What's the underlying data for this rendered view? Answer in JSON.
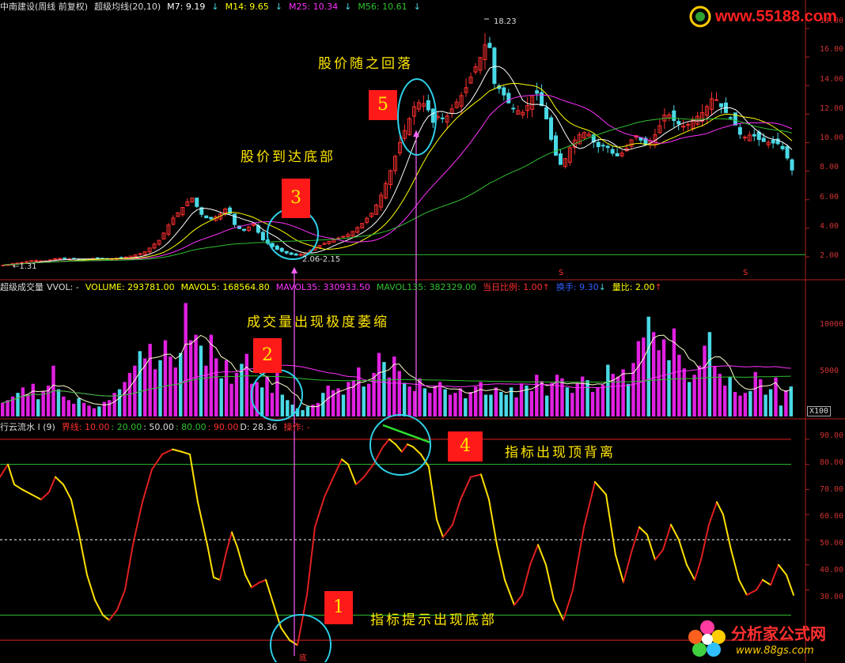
{
  "price_header": {
    "name": "中南建设(周线 前复权)",
    "indicator": "超级均线(20,10)",
    "m7": "M7: 9.19",
    "m14": "M14: 9.65",
    "m25": "M25: 10.34",
    "m56": "M56: 10.61",
    "arrow": "↓"
  },
  "volume_header": {
    "name": "超级成交量",
    "vvol": "VVOL: -",
    "volume": "VOLUME: 293781.00",
    "mavol5": "MAVOL5: 168564.80",
    "mavol35": "MAVOL35: 330933.50",
    "mavol135": "MAVOL135: 382329.00",
    "ratio": "当日比例: 1.00",
    "turnover": "换手: 9.30",
    "liangbi": "量比: 2.00",
    "up_arrow": "↑",
    "down_arrow": "↓"
  },
  "osc_header": {
    "name": "行云流水 I (9)",
    "jiexian": "界线: 10.00",
    "v20": ": 20.00",
    "v50": ": 50.00",
    "v80": ": 80.00",
    "v90": ": 90.00",
    "d": "D: 28.36",
    "op": "操作: -"
  },
  "price_axis": [
    "18.00",
    "16.00",
    "14.00",
    "12.00",
    "10.00",
    "8.00",
    "6.00",
    "4.00",
    "2.00"
  ],
  "volume_axis": [
    "10000",
    "5000"
  ],
  "volume_unit": "X100",
  "osc_axis": [
    "90.00",
    "80.00",
    "70.00",
    "60.00",
    "50.00",
    "40.00",
    "30.00"
  ],
  "price_labels": {
    "high": "18.23",
    "low_start": "1.31",
    "bottom_range": "2.06-2.15",
    "signal_marker": "S",
    "bottom_marker": "底"
  },
  "annotations": {
    "one": {
      "num": "1",
      "text": "指标提示出现底部"
    },
    "two": {
      "num": "2",
      "text": "成交量出现极度萎缩"
    },
    "three": {
      "num": "3",
      "text": "股价到达底部"
    },
    "four": {
      "num": "4",
      "text": "指标出现顶背离"
    },
    "five": {
      "num": "5",
      "text": "股价随之回落"
    }
  },
  "logos": {
    "top": "www.55188.com",
    "bottom_cn": "分析家公式网",
    "bottom_url": "www.88gs.com"
  },
  "colors": {
    "up": "#ff3030",
    "down": "#4ad9e6",
    "m7": "#ffffff",
    "m14": "#ffff00",
    "m25": "#ff30ff",
    "m56": "#30c030",
    "vol_bar": "#e020e0",
    "osc_up": "#e02020",
    "osc_down": "#ffe000",
    "circle": "#2ed0e8"
  },
  "chart_data": [
    {
      "type": "candlestick",
      "title": "中南建设(周线 前复权)",
      "ylim": [
        1,
        19
      ],
      "y_ticks": [
        2,
        4,
        6,
        8,
        10,
        12,
        14,
        16,
        18
      ],
      "series": [
        {
          "name": "M7",
          "last": 9.19
        },
        {
          "name": "M14",
          "last": 9.65
        },
        {
          "name": "M25",
          "last": 10.34
        },
        {
          "name": "M56",
          "last": 10.61
        }
      ],
      "annotations": [
        {
          "label": "18.23",
          "value": 18.23
        },
        {
          "label": "1.31",
          "value": 1.31
        },
        {
          "label": "2.06-2.15",
          "value": [
            2.06,
            2.15
          ]
        }
      ],
      "path_points": [
        [
          0,
          1.4
        ],
        [
          12,
          1.5
        ],
        [
          25,
          1.6
        ],
        [
          40,
          1.75
        ],
        [
          55,
          1.7
        ],
        [
          70,
          1.9
        ],
        [
          85,
          1.85
        ],
        [
          100,
          1.8
        ],
        [
          120,
          1.9
        ],
        [
          140,
          1.85
        ],
        [
          160,
          2.0
        ],
        [
          180,
          2.3
        ],
        [
          200,
          3.2
        ],
        [
          215,
          4.6
        ],
        [
          228,
          5.4
        ],
        [
          240,
          6.2
        ],
        [
          252,
          5.0
        ],
        [
          262,
          4.6
        ],
        [
          275,
          4.9
        ],
        [
          285,
          5.5
        ],
        [
          295,
          4.2
        ],
        [
          305,
          3.8
        ],
        [
          318,
          4.3
        ],
        [
          330,
          3.2
        ],
        [
          345,
          2.6
        ],
        [
          358,
          2.3
        ],
        [
          370,
          2.1
        ],
        [
          382,
          2.2
        ],
        [
          395,
          2.6
        ],
        [
          410,
          3.0
        ],
        [
          425,
          3.3
        ],
        [
          440,
          3.6
        ],
        [
          455,
          4.3
        ],
        [
          470,
          5.2
        ],
        [
          482,
          6.6
        ],
        [
          492,
          8.1
        ],
        [
          502,
          9.8
        ],
        [
          512,
          11.2
        ],
        [
          522,
          12.6
        ],
        [
          530,
          12.9
        ],
        [
          538,
          12.5
        ],
        [
          545,
          11.4
        ],
        [
          552,
          11.9
        ],
        [
          560,
          11.6
        ],
        [
          572,
          12.6
        ],
        [
          585,
          13.6
        ],
        [
          598,
          15.2
        ],
        [
          608,
          16.3
        ],
        [
          615,
          17.6
        ],
        [
          622,
          14.2
        ],
        [
          632,
          13.6
        ],
        [
          645,
          12.4
        ],
        [
          660,
          12.1
        ],
        [
          675,
          13.7
        ],
        [
          688,
          11.8
        ],
        [
          698,
          9.4
        ],
        [
          708,
          8.3
        ],
        [
          718,
          9.6
        ],
        [
          728,
          10.5
        ],
        [
          740,
          10.8
        ],
        [
          752,
          9.7
        ],
        [
          764,
          9.8
        ],
        [
          776,
          9.0
        ],
        [
          788,
          9.4
        ],
        [
          800,
          10.6
        ],
        [
          815,
          9.8
        ],
        [
          828,
          10.7
        ],
        [
          840,
          12.2
        ],
        [
          852,
          11.4
        ],
        [
          864,
          11.1
        ],
        [
          876,
          11.7
        ],
        [
          888,
          12.2
        ],
        [
          900,
          13.3
        ],
        [
          912,
          12.3
        ],
        [
          924,
          11.6
        ],
        [
          936,
          10.3
        ],
        [
          948,
          10.6
        ],
        [
          960,
          10.1
        ],
        [
          972,
          10.0
        ],
        [
          984,
          9.9
        ],
        [
          996,
          8.6
        ],
        [
          1003,
          7.4
        ]
      ]
    },
    {
      "type": "bar",
      "title": "超级成交量",
      "y_ticks": [
        5000,
        10000
      ],
      "unit": "X100",
      "series": [
        {
          "name": "VOLUME",
          "last": 293781.0
        },
        {
          "name": "MAVOL5",
          "last": 168564.8
        },
        {
          "name": "MAVOL35",
          "last": 330933.5
        },
        {
          "name": "MAVOL135",
          "last": 382329.0
        }
      ],
      "values": [
        1500,
        1800,
        2200,
        2600,
        3200,
        2400,
        3600,
        1900,
        2800,
        3400,
        5600,
        3000,
        2200,
        1800,
        1400,
        2000,
        1500,
        1200,
        900,
        1100,
        1600,
        1800,
        2600,
        3000,
        3800,
        4800,
        5600,
        7200,
        6400,
        8000,
        5200,
        6200,
        8400,
        6600,
        5400,
        7000,
        12500,
        8400,
        9000,
        7800,
        5600,
        9000,
        6400,
        4200,
        6200,
        3600,
        4800,
        5800,
        6900,
        3600,
        3800,
        3200,
        4400,
        2600,
        5000,
        2400,
        1800,
        1300,
        900,
        700,
        1100,
        1300,
        1500,
        2600,
        3400,
        2900,
        3100,
        2400,
        3800,
        4000,
        5400,
        3300,
        3600,
        4800,
        7000,
        6000,
        4300,
        6600,
        5000,
        3700,
        3300,
        2800,
        4200,
        3100,
        2600,
        3300,
        3800,
        3000,
        2400,
        2600,
        3100,
        2000,
        2700,
        3300,
        3800,
        2400,
        2400,
        3200,
        2700,
        2400,
        3200,
        2100,
        3600,
        3400,
        2800,
        4600,
        3900,
        2300,
        3700,
        4600,
        4200,
        3200,
        2600,
        3700,
        4400,
        4000,
        2700,
        3200,
        3500,
        5700,
        4700,
        4400,
        5200,
        3600,
        5900,
        8300,
        8700,
        11000,
        9300,
        7300,
        8500,
        6200,
        9700,
        6800,
        5300,
        3800,
        4600,
        5600,
        7800,
        9300,
        5500,
        4700,
        3400,
        4400,
        2700,
        2300,
        2600,
        2800,
        4900,
        4100,
        2400,
        3000,
        4300,
        1200,
        2900,
        3300
      ]
    },
    {
      "type": "line",
      "title": "行云流水 I (9)",
      "ylim": [
        5,
        95
      ],
      "y_ticks": [
        30,
        40,
        50,
        60,
        70,
        80,
        90
      ],
      "reference_lines": [
        10,
        20,
        50,
        80,
        90
      ],
      "series": [
        {
          "name": "D",
          "last": 28.36
        }
      ],
      "path_points": [
        [
          0,
          75
        ],
        [
          10,
          80
        ],
        [
          18,
          72
        ],
        [
          28,
          70
        ],
        [
          40,
          68
        ],
        [
          52,
          66
        ],
        [
          62,
          69
        ],
        [
          70,
          75
        ],
        [
          80,
          72
        ],
        [
          90,
          66
        ],
        [
          100,
          52
        ],
        [
          110,
          36
        ],
        [
          120,
          26
        ],
        [
          130,
          20
        ],
        [
          138,
          18
        ],
        [
          148,
          22
        ],
        [
          158,
          30
        ],
        [
          168,
          48
        ],
        [
          180,
          65
        ],
        [
          192,
          78
        ],
        [
          205,
          84
        ],
        [
          218,
          86
        ],
        [
          230,
          85
        ],
        [
          240,
          84
        ],
        [
          250,
          65
        ],
        [
          262,
          48
        ],
        [
          270,
          35
        ],
        [
          278,
          34
        ],
        [
          286,
          45
        ],
        [
          293,
          53
        ],
        [
          300,
          47
        ],
        [
          310,
          36
        ],
        [
          318,
          31
        ],
        [
          328,
          33
        ],
        [
          336,
          34
        ],
        [
          345,
          25
        ],
        [
          355,
          15
        ],
        [
          366,
          10
        ],
        [
          376,
          8
        ],
        [
          388,
          28
        ],
        [
          398,
          55
        ],
        [
          410,
          67
        ],
        [
          420,
          74
        ],
        [
          432,
          82
        ],
        [
          440,
          80
        ],
        [
          450,
          72
        ],
        [
          460,
          75
        ],
        [
          472,
          80
        ],
        [
          484,
          87
        ],
        [
          492,
          90
        ],
        [
          500,
          88
        ],
        [
          508,
          85
        ],
        [
          515,
          88
        ],
        [
          522,
          87
        ],
        [
          532,
          84
        ],
        [
          542,
          79
        ],
        [
          552,
          58
        ],
        [
          560,
          51
        ],
        [
          572,
          56
        ],
        [
          582,
          66
        ],
        [
          595,
          75
        ],
        [
          608,
          76
        ],
        [
          618,
          66
        ],
        [
          628,
          48
        ],
        [
          638,
          34
        ],
        [
          650,
          24
        ],
        [
          660,
          28
        ],
        [
          670,
          40
        ],
        [
          680,
          48
        ],
        [
          690,
          40
        ],
        [
          700,
          26
        ],
        [
          712,
          18
        ],
        [
          724,
          30
        ],
        [
          738,
          55
        ],
        [
          752,
          73
        ],
        [
          766,
          68
        ],
        [
          778,
          44
        ],
        [
          788,
          33
        ],
        [
          798,
          45
        ],
        [
          808,
          55
        ],
        [
          818,
          52
        ],
        [
          828,
          42
        ],
        [
          838,
          46
        ],
        [
          848,
          56
        ],
        [
          858,
          50
        ],
        [
          868,
          40
        ],
        [
          878,
          34
        ],
        [
          886,
          42
        ],
        [
          896,
          56
        ],
        [
          906,
          65
        ],
        [
          914,
          60
        ],
        [
          924,
          46
        ],
        [
          934,
          34
        ],
        [
          944,
          28
        ],
        [
          956,
          30
        ],
        [
          964,
          34
        ],
        [
          974,
          32
        ],
        [
          984,
          40
        ],
        [
          994,
          36
        ],
        [
          1003,
          28
        ]
      ]
    }
  ]
}
